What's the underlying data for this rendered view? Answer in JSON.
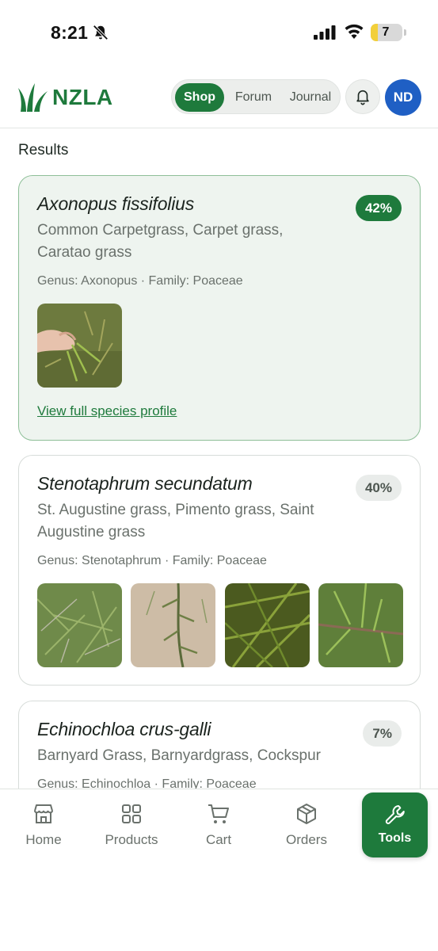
{
  "status_bar": {
    "time": "8:21",
    "battery": "7"
  },
  "header": {
    "brand": "NZLA",
    "tabs": [
      {
        "label": "Shop",
        "active": true
      },
      {
        "label": "Forum",
        "active": false
      },
      {
        "label": "Journal",
        "active": false
      }
    ],
    "avatar_initials": "ND",
    "colors": {
      "brand": "#1e7a3c",
      "avatar": "#1f5fc4"
    }
  },
  "results": {
    "heading": "Results",
    "items": [
      {
        "scientific_name": "Axonopus fissifolius",
        "common_names": "Common Carpetgrass, Carpet grass, Carataо grass",
        "meta": "Genus: Axonopus · Family: Poaceae",
        "confidence": "42%",
        "image_count": 1,
        "link": "View full species profile"
      },
      {
        "scientific_name": "Stenotaphrum secundatum",
        "common_names": "St. Augustine grass, Pimento grass, Saint Augustine grass",
        "meta": "Genus: Stenotaphrum · Family: Poaceae",
        "confidence": "40%",
        "image_count": 4
      },
      {
        "scientific_name": "Echinochloa crus-galli",
        "common_names": "Barnyard Grass, Barnyardgrass, Cockspur",
        "meta": "Genus: Echinochloa · Family: Poaceae",
        "confidence": "7%"
      }
    ]
  },
  "bottom_nav": [
    {
      "label": "Home",
      "icon": "store-icon"
    },
    {
      "label": "Products",
      "icon": "grid-icon"
    },
    {
      "label": "Cart",
      "icon": "cart-icon"
    },
    {
      "label": "Orders",
      "icon": "box-icon"
    },
    {
      "label": "Tools",
      "icon": "wrench-icon",
      "active": true
    }
  ]
}
